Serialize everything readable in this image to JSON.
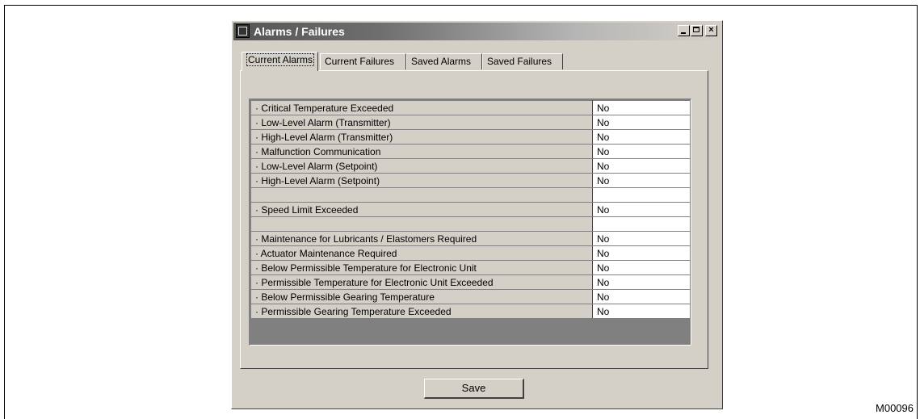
{
  "window": {
    "title": "Alarms / Failures",
    "controls": {
      "minimize": "_",
      "maximize": "□",
      "close": "×"
    }
  },
  "tabs": [
    {
      "label": "Current Alarms",
      "active": true
    },
    {
      "label": "Current Failures",
      "active": false
    },
    {
      "label": "Saved Alarms",
      "active": false
    },
    {
      "label": "Saved Failures",
      "active": false
    }
  ],
  "table": {
    "rows": [
      {
        "label": "· Critical Temperature Exceeded",
        "value": "No"
      },
      {
        "label": "· Low-Level Alarm (Transmitter)",
        "value": "No"
      },
      {
        "label": "· High-Level Alarm (Transmitter)",
        "value": "No"
      },
      {
        "label": "· Malfunction Communication",
        "value": "No"
      },
      {
        "label": "· Low-Level Alarm (Setpoint)",
        "value": "No"
      },
      {
        "label": "· High-Level Alarm (Setpoint)",
        "value": "No"
      },
      {
        "label": "",
        "value": ""
      },
      {
        "label": "· Speed Limit Exceeded",
        "value": "No"
      },
      {
        "label": "",
        "value": ""
      },
      {
        "label": "· Maintenance for Lubricants / Elastomers Required",
        "value": "No"
      },
      {
        "label": "· Actuator Maintenance Required",
        "value": "No"
      },
      {
        "label": "· Below Permissible Temperature for Electronic Unit",
        "value": "No"
      },
      {
        "label": "· Permissible Temperature for Electronic Unit Exceeded",
        "value": "No"
      },
      {
        "label": "· Below Permissible Gearing Temperature",
        "value": "No"
      },
      {
        "label": "· Permissible Gearing Temperature Exceeded",
        "value": "No"
      }
    ]
  },
  "buttons": {
    "save": "Save"
  },
  "figure_id": "M00096",
  "icons": {
    "app": "app-window-icon"
  }
}
